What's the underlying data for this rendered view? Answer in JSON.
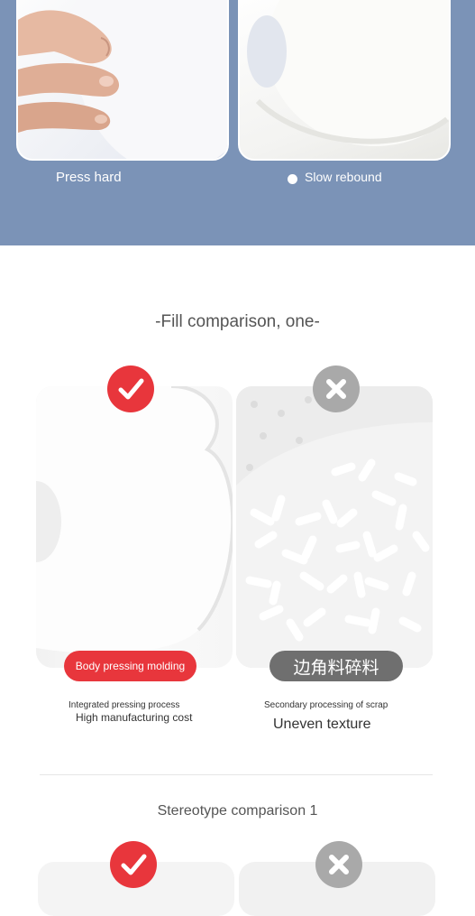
{
  "top_section": {
    "press_caption": "Press hard",
    "rebound_caption": "Slow rebound"
  },
  "fill_comparison": {
    "title": "-Fill comparison, one-",
    "left": {
      "pill_label": "Body pressing molding",
      "small_note": "Integrated pressing process",
      "main_note": "High manufacturing cost"
    },
    "right": {
      "pill_label": "边角料碎料",
      "small_note": "Secondary processing of scrap",
      "main_note": "Uneven texture"
    }
  },
  "stereotype_comparison": {
    "title": "Stereotype comparison 1"
  },
  "colors": {
    "band": "#7b93b7",
    "good": "#e8363c",
    "bad": "#a9a9a9"
  },
  "icons": {
    "good": "check-icon",
    "bad": "cross-icon"
  }
}
